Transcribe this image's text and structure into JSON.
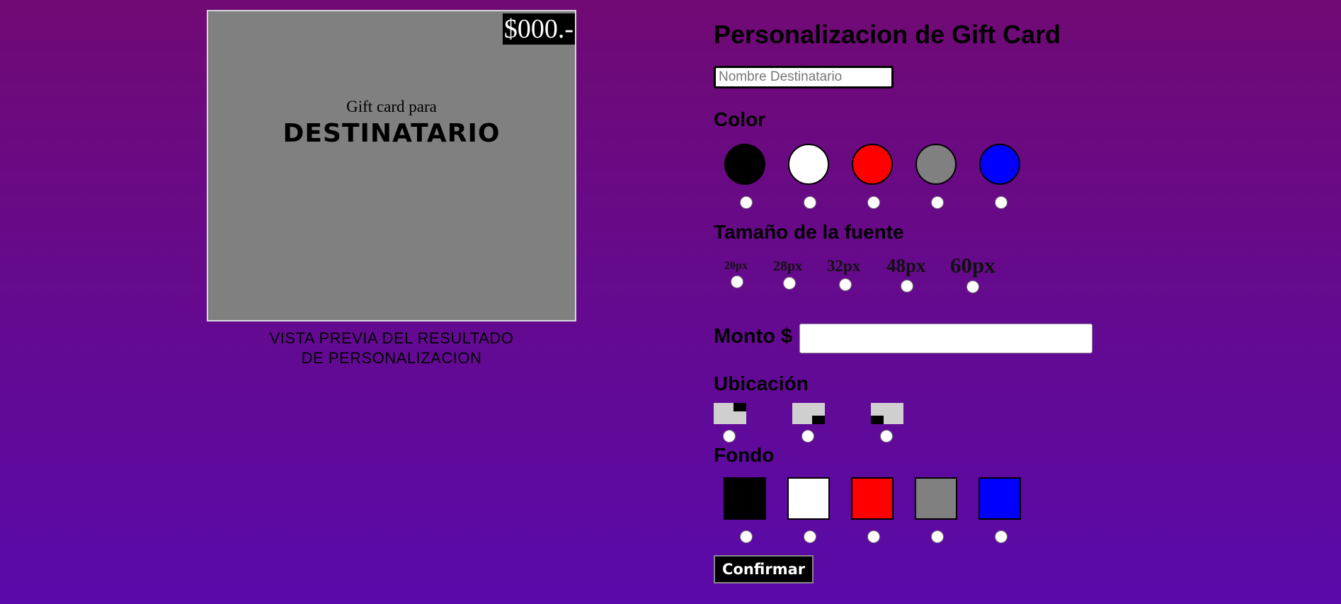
{
  "preview": {
    "amount": "$000.-",
    "gift_for": "Gift card para",
    "recipient": "DESTINATARIO",
    "caption_line1": "VISTA PREVIA DEL RESULTADO",
    "caption_line2": "DE PERSONALIZACION",
    "card_color": "#808080"
  },
  "form": {
    "title": "Personalizacion de Gift Card",
    "name_placeholder": "Nombre Destinatario",
    "color_label": "Color",
    "colors": [
      "#000000",
      "#ffffff",
      "#ff0000",
      "#808080",
      "#0000ff"
    ],
    "font_size_label": "Tamaño de la fuente",
    "font_sizes": [
      "20px",
      "28px",
      "32px",
      "48px",
      "60px"
    ],
    "amount_label": "Monto $",
    "amount_value": "",
    "location_label": "Ubicación",
    "locations": [
      "top-right",
      "bottom-right",
      "bottom-left"
    ],
    "background_label": "Fondo",
    "backgrounds": [
      "#000000",
      "#ffffff",
      "#ff0000",
      "#808080",
      "#0000ff"
    ],
    "confirm_label": "Confirmar"
  }
}
